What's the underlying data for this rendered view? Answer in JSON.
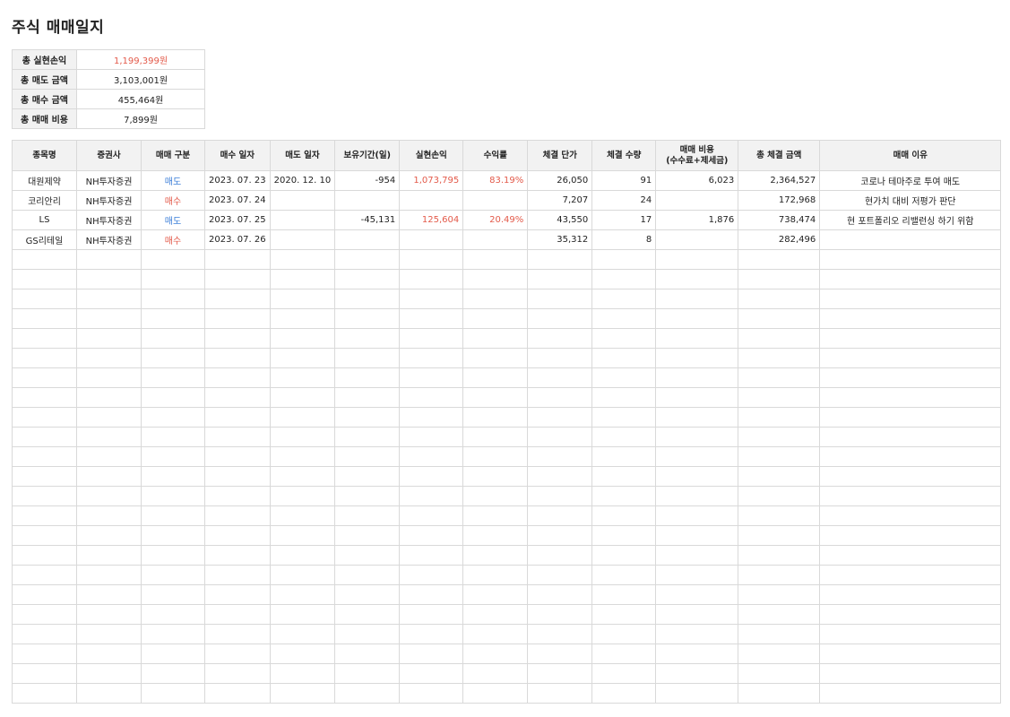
{
  "page": {
    "title": "주식 매매일지"
  },
  "summary": [
    {
      "label": "총 실현손익",
      "value": "1,199,399원",
      "color": "#e35a4a"
    },
    {
      "label": "총 매도 금액",
      "value": "3,103,001원",
      "color": ""
    },
    {
      "label": "총 매수 금액",
      "value": "455,464원",
      "color": ""
    },
    {
      "label": "총 매매 비용",
      "value": "7,899원",
      "color": ""
    }
  ],
  "table": {
    "headers": [
      "종목명",
      "증권사",
      "매매 구분",
      "매수 일자",
      "매도 일자",
      "보유기간(일)",
      "실현손익",
      "수익률",
      "체결 단가",
      "체결 수량",
      "매매 비용\n(수수료+제세금)",
      "총 체결 금액",
      "매매 이유"
    ],
    "rows": [
      {
        "name": "대원제약",
        "broker": "NH투자증권",
        "type": "매도",
        "type_color": "#3d7fd8",
        "buy_date": "2023. 07. 23",
        "sell_date": "2020. 12. 10",
        "hold_days": "-954",
        "profit": "1,073,795",
        "rate": "83.19%",
        "price": "26,050",
        "qty": "91",
        "cost": "6,023",
        "total": "2,364,527",
        "reason": "코로나 테마주로 투여 매도"
      },
      {
        "name": "코리안리",
        "broker": "NH투자증권",
        "type": "매수",
        "type_color": "#e35a4a",
        "buy_date": "2023. 07. 24",
        "sell_date": "",
        "hold_days": "",
        "profit": "",
        "rate": "",
        "price": "7,207",
        "qty": "24",
        "cost": "",
        "total": "172,968",
        "reason": "현가치 대비 저평가 판단"
      },
      {
        "name": "LS",
        "broker": "NH투자증권",
        "type": "매도",
        "type_color": "#3d7fd8",
        "buy_date": "2023. 07. 25",
        "sell_date": "",
        "hold_days": "-45,131",
        "profit": "125,604",
        "rate": "20.49%",
        "price": "43,550",
        "qty": "17",
        "cost": "1,876",
        "total": "738,474",
        "reason": "현 포트폴리오 리밸런싱 하기 위함"
      },
      {
        "name": "GS리테일",
        "broker": "NH투자증권",
        "type": "매수",
        "type_color": "#e35a4a",
        "buy_date": "2023. 07. 26",
        "sell_date": "",
        "hold_days": "",
        "profit": "",
        "rate": "",
        "price": "35,312",
        "qty": "8",
        "cost": "",
        "total": "282,496",
        "reason": ""
      }
    ],
    "profit_color": "#e35a4a"
  }
}
